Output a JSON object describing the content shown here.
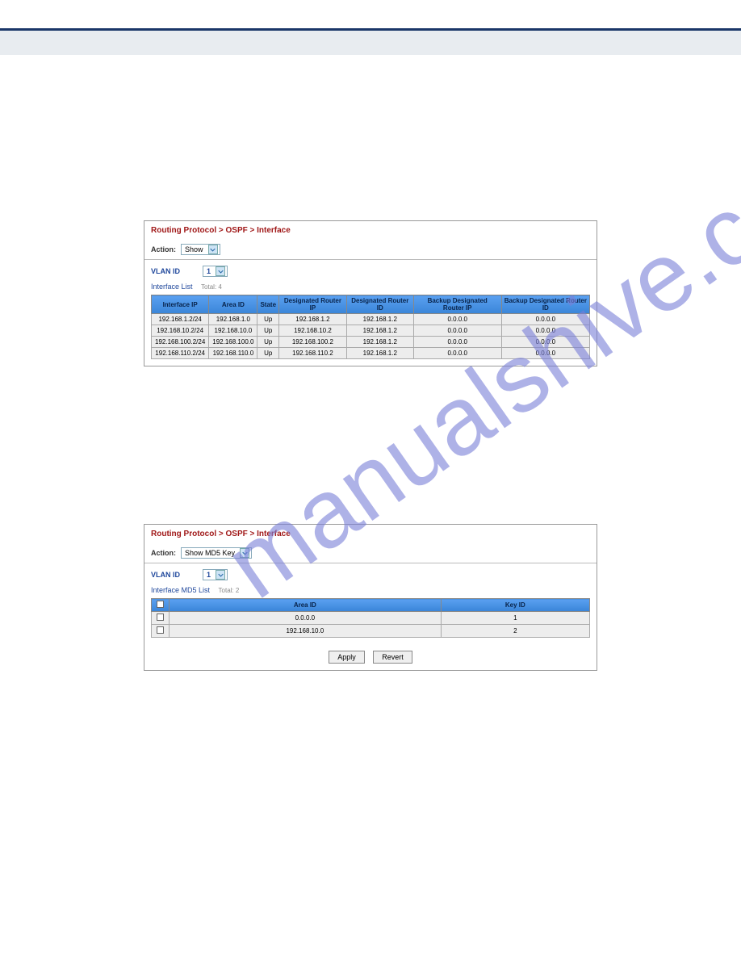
{
  "watermark": "manualshive.com",
  "panel1": {
    "breadcrumb": "Routing Protocol > OSPF > Interface",
    "action_label": "Action:",
    "action_value": "Show",
    "vlan_label": "VLAN ID",
    "vlan_value": "1",
    "list_title": "Interface List",
    "list_total": "Total: 4",
    "headers": [
      "Interface IP",
      "Area ID",
      "State",
      "Designated Router IP",
      "Designated Router ID",
      "Backup Designated Router IP",
      "Backup Designated Router ID"
    ],
    "rows": [
      {
        "iface": "192.168.1.2/24",
        "area": "192.168.1.0",
        "state": "Up",
        "drip": "192.168.1.2",
        "drid": "192.168.1.2",
        "bdrip": "0.0.0.0",
        "bdrid": "0.0.0.0"
      },
      {
        "iface": "192.168.10.2/24",
        "area": "192.168.10.0",
        "state": "Up",
        "drip": "192.168.10.2",
        "drid": "192.168.1.2",
        "bdrip": "0.0.0.0",
        "bdrid": "0.0.0.0"
      },
      {
        "iface": "192.168.100.2/24",
        "area": "192.168.100.0",
        "state": "Up",
        "drip": "192.168.100.2",
        "drid": "192.168.1.2",
        "bdrip": "0.0.0.0",
        "bdrid": "0.0.0.0"
      },
      {
        "iface": "192.168.110.2/24",
        "area": "192.168.110.0",
        "state": "Up",
        "drip": "192.168.110.2",
        "drid": "192.168.1.2",
        "bdrip": "0.0.0.0",
        "bdrid": "0.0.0.0"
      }
    ]
  },
  "panel2": {
    "breadcrumb": "Routing Protocol > OSPF > Interface",
    "action_label": "Action:",
    "action_value": "Show MD5 Key",
    "vlan_label": "VLAN ID",
    "vlan_value": "1",
    "list_title": "Interface MD5 List",
    "list_total": "Total: 2",
    "headers": [
      "Area ID",
      "Key ID"
    ],
    "rows": [
      {
        "area": "0.0.0.0",
        "key": "1"
      },
      {
        "area": "192.168.10.0",
        "key": "2"
      }
    ],
    "apply": "Apply",
    "revert": "Revert"
  }
}
